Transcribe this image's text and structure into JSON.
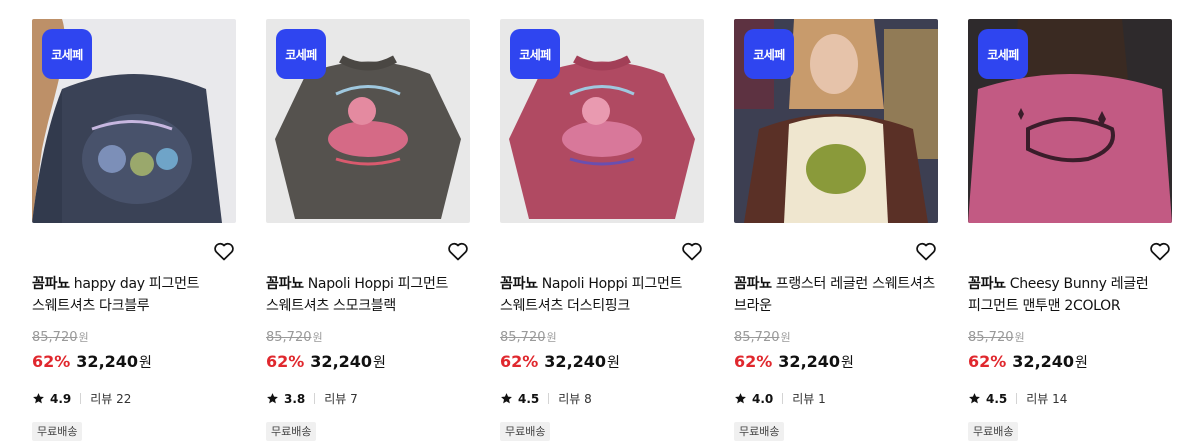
{
  "products": [
    {
      "badge": "코세페",
      "brand": "꼼파뇨",
      "name": "happy day 피그먼트 스웨트셔츠 다크블루",
      "original_price": "85,720",
      "discount": "62%",
      "price": "32,240",
      "currency": "원",
      "rating": "4.9",
      "reviews": "리뷰 22",
      "shipping": "무료배송",
      "image": "navy-sweatshirt-model-photo",
      "image_color": "#3a4256"
    },
    {
      "badge": "코세페",
      "brand": "꼼파뇨",
      "name": "Napoli Hoppi 피그먼트 스웨트셔츠 스모크블랙",
      "original_price": "85,720",
      "discount": "62%",
      "price": "32,240",
      "currency": "원",
      "rating": "3.8",
      "reviews": "리뷰 7",
      "shipping": "무료배송",
      "image": "charcoal-sweatshirt-product-photo",
      "image_color": "#55524e"
    },
    {
      "badge": "코세페",
      "brand": "꼼파뇨",
      "name": "Napoli Hoppi 피그먼트 스웨트셔츠 더스티핑크",
      "original_price": "85,720",
      "discount": "62%",
      "price": "32,240",
      "currency": "원",
      "rating": "4.5",
      "reviews": "리뷰 8",
      "shipping": "무료배송",
      "image": "pink-sweatshirt-product-photo",
      "image_color": "#b04a62"
    },
    {
      "badge": "코세페",
      "brand": "꼼파뇨",
      "name": "프랭스터 레글런 스웨트셔츠 브라운",
      "original_price": "85,720",
      "discount": "62%",
      "price": "32,240",
      "currency": "원",
      "rating": "4.0",
      "reviews": "리뷰 1",
      "shipping": "무료배송",
      "image": "brown-raglan-sweatshirt-model-photo",
      "image_color": "#5a3026"
    },
    {
      "badge": "코세페",
      "brand": "꼼파뇨",
      "name": "Cheesy Bunny 레글런 피그먼트 맨투맨 2COLOR",
      "original_price": "85,720",
      "discount": "62%",
      "price": "32,240",
      "currency": "원",
      "rating": "4.5",
      "reviews": "리뷰 14",
      "shipping": "무료배송",
      "image": "pink-raglan-sweatshirt-model-photo",
      "image_color": "#c25a83"
    }
  ],
  "colors": {
    "badge": "#2f45f0",
    "discount": "#e0282e",
    "original_price": "#9a9a9a"
  }
}
